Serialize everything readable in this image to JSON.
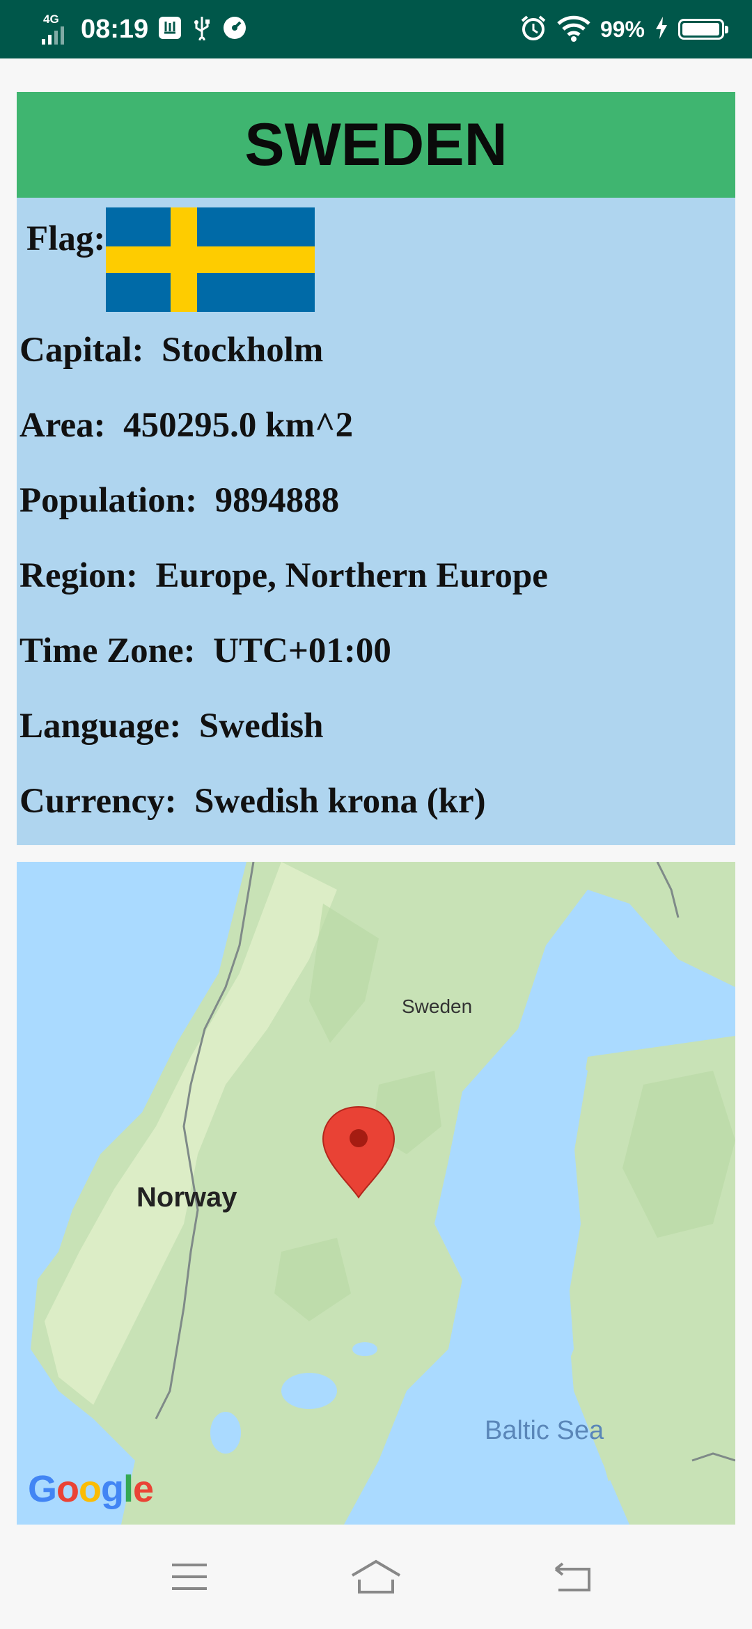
{
  "status_bar": {
    "network": "4G",
    "time": "08:19",
    "battery": "99%",
    "battery_level": 0.99
  },
  "country": {
    "name": "SWEDEN",
    "flag_label": "Flag:",
    "fields": [
      {
        "label": "Capital:",
        "value": "Stockholm"
      },
      {
        "label": "Area:",
        "value": "450295.0 km^2"
      },
      {
        "label": "Population:",
        "value": "9894888"
      },
      {
        "label": "Region:",
        "value": "Europe, Northern Europe"
      },
      {
        "label": "Time Zone:",
        "value": "UTC+01:00"
      },
      {
        "label": "Language:",
        "value": "Swedish"
      },
      {
        "label": "Currency:",
        "value": "Swedish krona (kr)"
      }
    ]
  },
  "map": {
    "labels": {
      "sweden": "Sweden",
      "norway": "Norway",
      "baltic": "Baltic Sea"
    },
    "attribution": [
      "G",
      "o",
      "o",
      "g",
      "l",
      "e"
    ]
  },
  "colors": {
    "status_bar": "#00574a",
    "header": "#3fb570",
    "body": "#afd5ef",
    "pin": "#e94235"
  },
  "nav": {
    "icons": [
      "menu-icon",
      "home-icon",
      "back-icon"
    ]
  }
}
